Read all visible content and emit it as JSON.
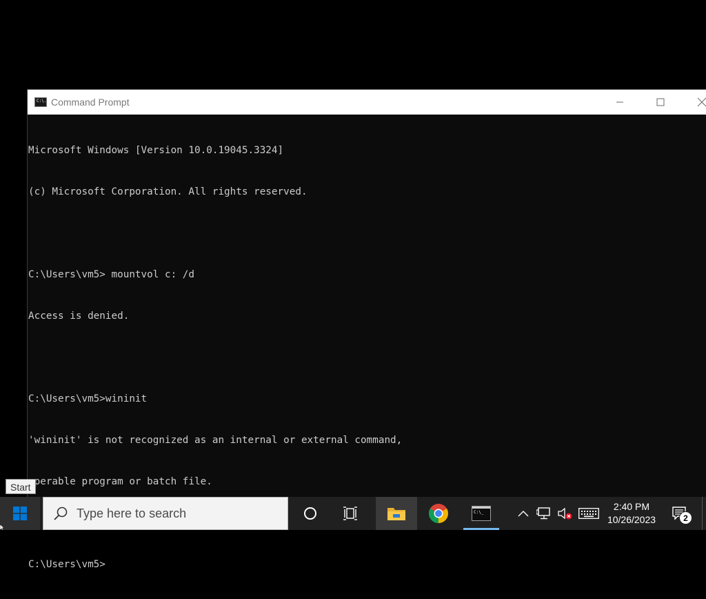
{
  "window": {
    "title": "Command Prompt",
    "minimize_glyph": "—",
    "maximize_glyph": "☐",
    "close_glyph": "✕"
  },
  "console": {
    "lines": [
      "Microsoft Windows [Version 10.0.19045.3324]",
      "(c) Microsoft Corporation. All rights reserved.",
      "",
      "C:\\Users\\vm5> mountvol c: /d",
      "Access is denied.",
      "",
      "C:\\Users\\vm5>wininit",
      "'wininit' is not recognized as an internal or external command,",
      "operable program or batch file.",
      "",
      "C:\\Users\\vm5>"
    ]
  },
  "tooltip": {
    "text": "Start"
  },
  "taskbar": {
    "search_placeholder": "Type here to search",
    "clock_time": "2:40 PM",
    "clock_date": "10/26/2023",
    "notification_count": "2",
    "icons": {
      "start": "windows-logo-icon",
      "search": "search-icon",
      "cortana": "cortana-circle-icon",
      "task_view": "task-view-icon",
      "explorer": "file-explorer-icon",
      "chrome": "chrome-icon",
      "cmd": "command-prompt-icon",
      "tray_chevron": "chevron-up-icon",
      "network": "network-icon",
      "volume": "volume-muted-icon",
      "keyboard": "touch-keyboard-icon",
      "notifications": "action-center-icon"
    },
    "colors": {
      "taskbar_bg": "#202020",
      "active_underline": "#76b9ed",
      "windows_blue": "#0078d7",
      "volume_error": "#e81123"
    }
  }
}
